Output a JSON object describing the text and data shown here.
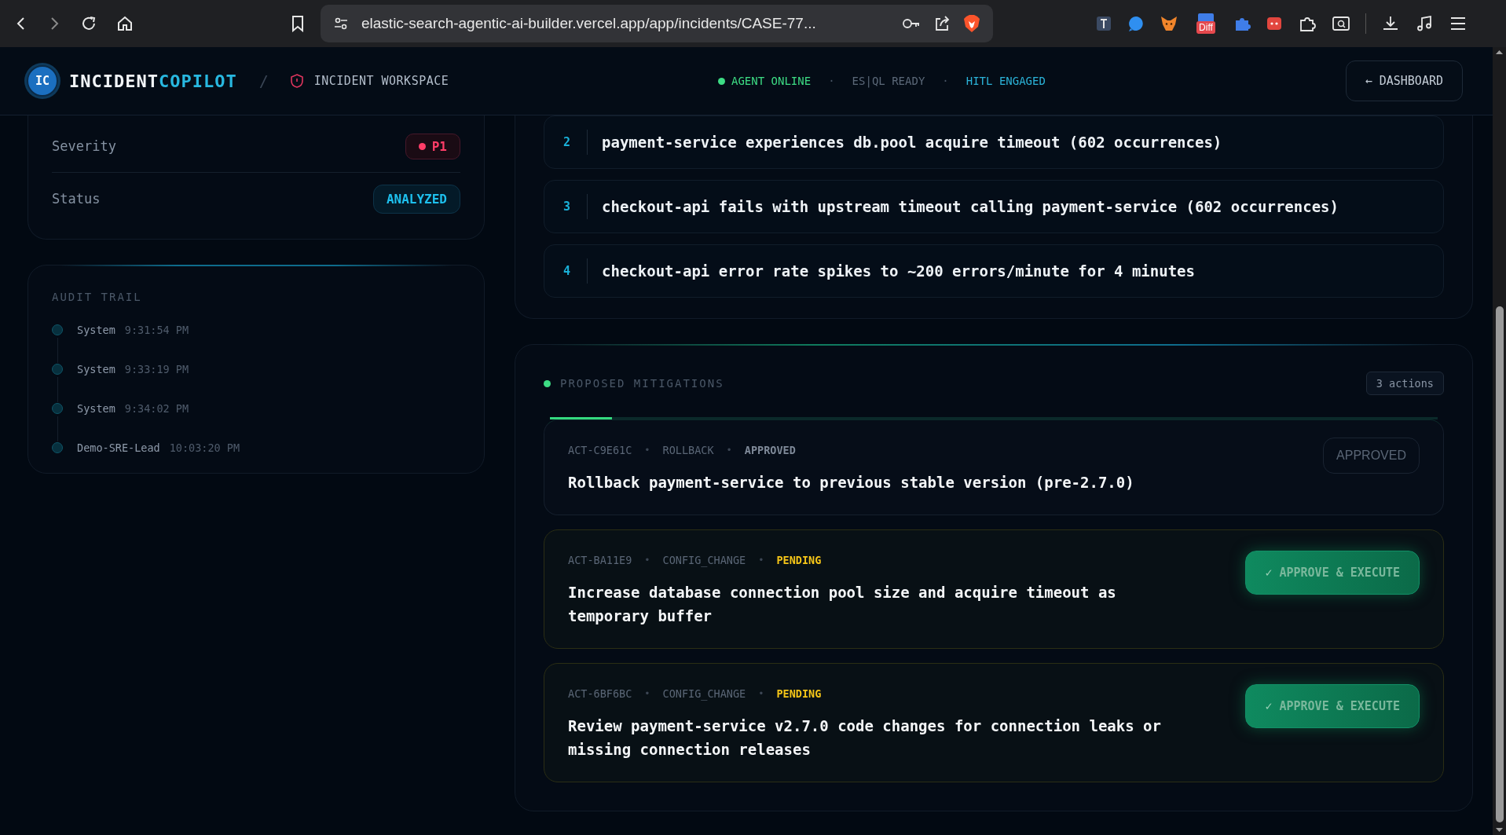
{
  "browser": {
    "url": "elastic-search-agentic-ai-builder.vercel.app/app/incidents/CASE-77...",
    "extension_badge": "Diff"
  },
  "header": {
    "logo_mark": "IC",
    "brand_first": "INCIDENT",
    "brand_second": "COPILOT",
    "separator": "/",
    "workspace": "INCIDENT WORKSPACE",
    "status_items": [
      {
        "label": "AGENT ONLINE",
        "kind": "online"
      },
      {
        "label": "ES|QL READY",
        "kind": "plain"
      },
      {
        "label": "HITL ENGAGED",
        "kind": "accent"
      }
    ],
    "status_separator": "·",
    "dashboard_arrow": "←",
    "dashboard_label": "DASHBOARD"
  },
  "summary": [
    {
      "label": "Severity",
      "value": "P1",
      "kind": "severity"
    },
    {
      "label": "Status",
      "value": "ANALYZED",
      "kind": "status"
    }
  ],
  "audit": {
    "title": "AUDIT TRAIL",
    "entries": [
      {
        "actor": "System",
        "time": "9:31:54 PM"
      },
      {
        "actor": "System",
        "time": "9:33:19 PM"
      },
      {
        "actor": "System",
        "time": "9:34:02 PM"
      },
      {
        "actor": "Demo-SRE-Lead",
        "time": "10:03:20 PM"
      }
    ]
  },
  "steps": [
    {
      "number": "2",
      "text": "payment-service experiences db.pool acquire timeout (602 occurrences)"
    },
    {
      "number": "3",
      "text": "checkout-api fails with upstream timeout calling payment-service (602 occurrences)"
    },
    {
      "number": "4",
      "text": "checkout-api error rate spikes to ~200 errors/minute for 4 minutes"
    }
  ],
  "mitigations": {
    "title": "PROPOSED MITIGATIONS",
    "count": "3 actions",
    "progress": {
      "level": 0.07
    },
    "meta_separator": "•",
    "actions": [
      {
        "id": "ACT-C9E61C",
        "type": "ROLLBACK",
        "status": "APPROVED",
        "kind": "approved",
        "title": "Rollback payment-service to previous stable version (pre-2.7.0)",
        "button": "APPROVED"
      },
      {
        "id": "ACT-BA11E9",
        "type": "CONFIG_CHANGE",
        "status": "PENDING",
        "kind": "pending",
        "title": "Increase database connection pool size and acquire timeout as temporary buffer",
        "button_icon": "✓",
        "button": "APPROVE & EXECUTE"
      },
      {
        "id": "ACT-6BF6BC",
        "type": "CONFIG_CHANGE",
        "status": "PENDING",
        "kind": "pending",
        "title": "Review payment-service v2.7.0 code changes for connection leaks or missing connection releases",
        "button_icon": "✓",
        "button": "APPROVE & EXECUTE"
      }
    ]
  }
}
